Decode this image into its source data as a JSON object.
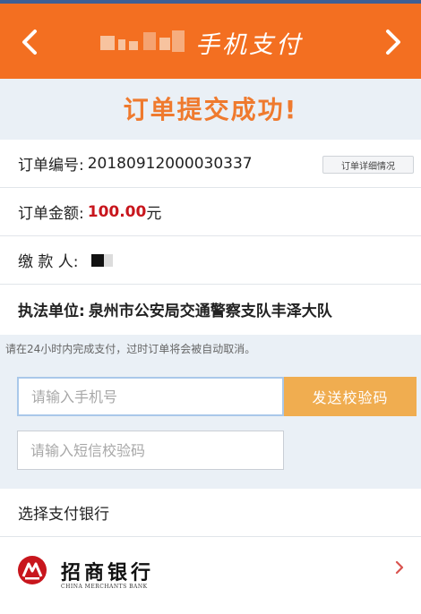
{
  "header": {
    "title": "手机支付",
    "icons": {
      "back": "chevron-left-icon",
      "forward": "chevron-right-icon"
    },
    "colors": {
      "bar": "#f36f21",
      "top_stripe": "#3d5f95"
    }
  },
  "status": {
    "heading": "订单提交成功!",
    "color": "#ef7a2e"
  },
  "order": {
    "number_label": "订单编号:",
    "number_value": "20180912000030337",
    "detail_button": "订单详细情况",
    "amount_label": "订单金额:",
    "amount_value": "100.00",
    "amount_unit": "元",
    "payer_label": "缴 款 人:",
    "agency_label": "执法单位:",
    "agency_value": "泉州市公安局交通警察支队丰泽大队"
  },
  "notice": "请在24小时内完成支付，过时订单将会被自动取消。",
  "verification": {
    "phone_placeholder": "请输入手机号",
    "send_button": "发送校验码",
    "code_placeholder": "请输入短信校验码",
    "button_color": "#f0ad50"
  },
  "bank": {
    "section_title": "选择支付银行",
    "name": "招商银行",
    "name_en": "CHINA MERCHANTS BANK",
    "logo_color": "#c8161d"
  }
}
